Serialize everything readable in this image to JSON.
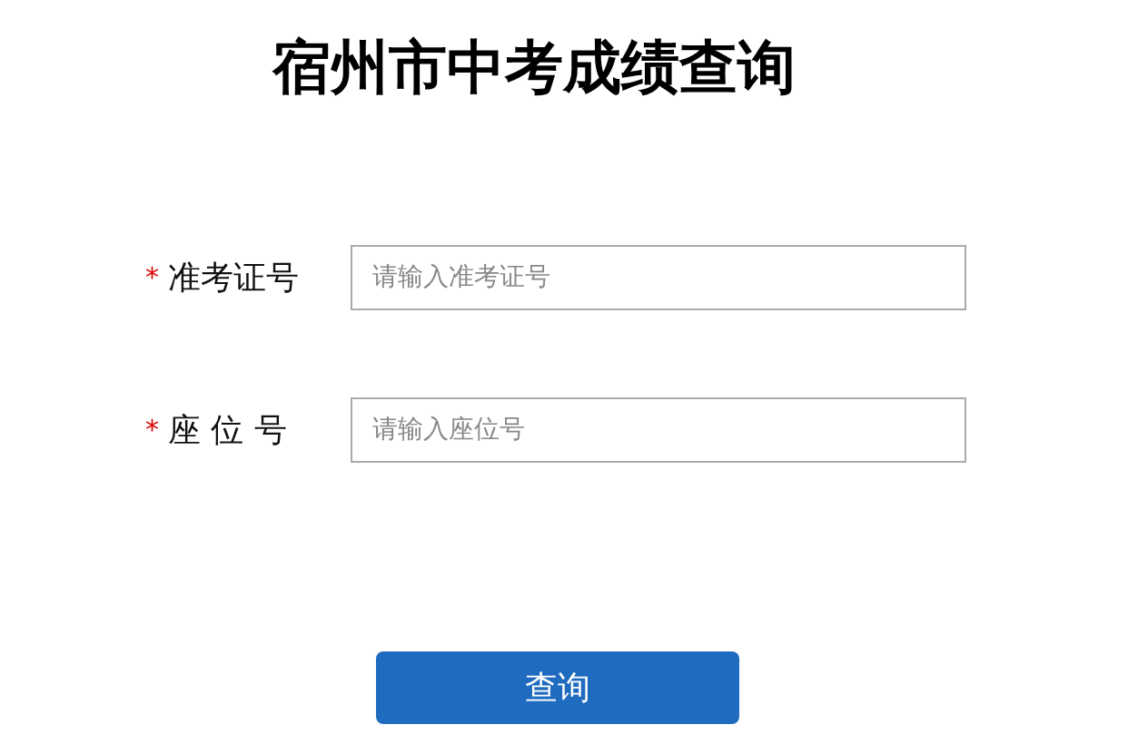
{
  "title": "宿州市中考成绩查询",
  "fields": [
    {
      "required_mark": "*",
      "label": "准考证号",
      "placeholder": "请输入准考证号"
    },
    {
      "required_mark": "*",
      "label": "座 位 号",
      "placeholder": "请输入座位号"
    }
  ],
  "submit_button": "查询"
}
